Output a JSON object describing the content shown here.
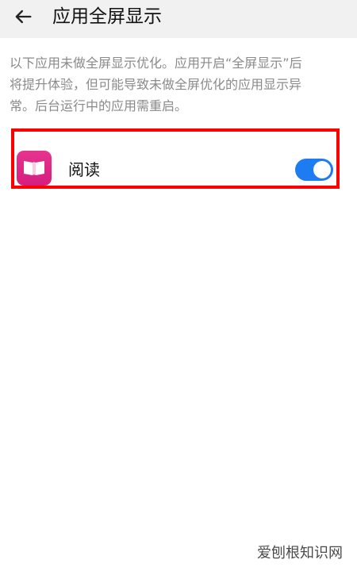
{
  "header": {
    "back_icon": "back-arrow-icon",
    "title": "应用全屏显示"
  },
  "description": "以下应用未做全屏显示优化。应用开启“全屏显示”后将提升体验，但可能导致未做全屏优化的应用显示异常。后台运行中的应用需重启。",
  "app_list": [
    {
      "name": "阅读",
      "icon": "book-app-icon",
      "fullscreen_enabled": true
    }
  ],
  "colors": {
    "header_bg": "#f1f1f1",
    "toggle_on": "#1e7cf2",
    "highlight_border": "#ff0000",
    "app_icon_bg": "#e0288a"
  },
  "watermark": "爱刨根知识网"
}
